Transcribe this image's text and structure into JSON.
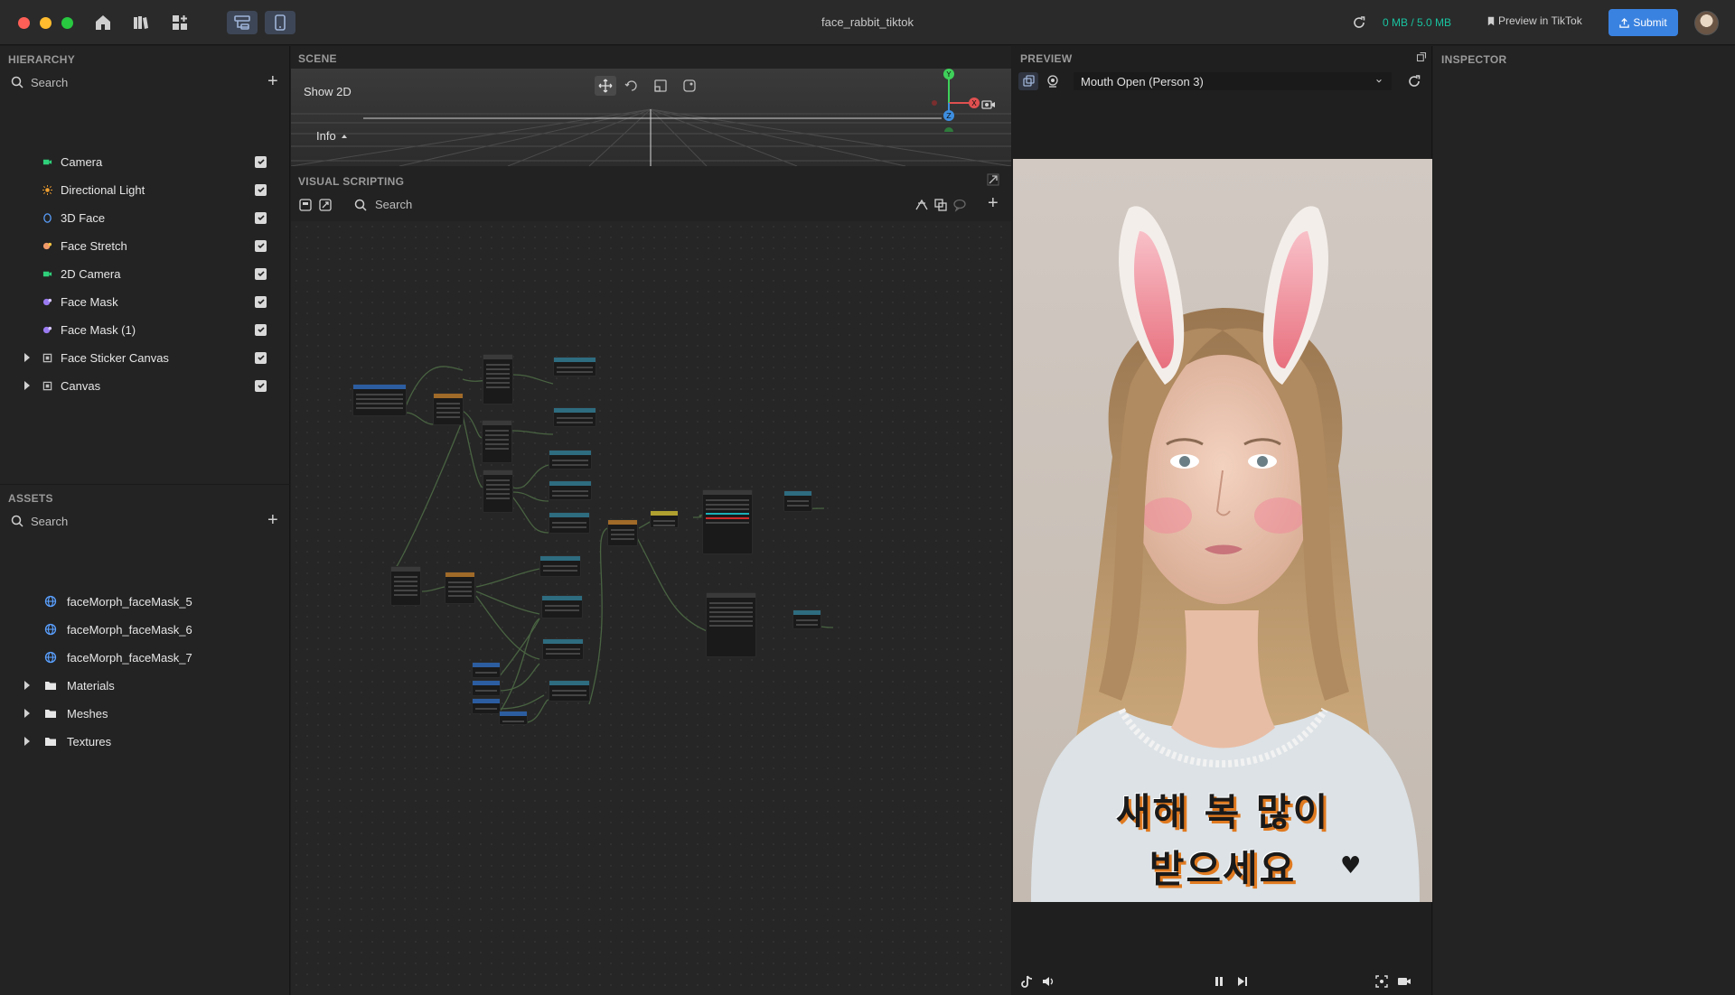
{
  "window": {
    "title": "face_rabbit_tiktok",
    "size_usage": "0 MB / 5.0 MB",
    "preview_in_tiktok_label": "Preview in TikTok",
    "submit_label": "Submit"
  },
  "hierarchy": {
    "title": "HIERARCHY",
    "search_placeholder": "Search",
    "items": [
      {
        "label": "Camera",
        "icon": "camera-icon",
        "color": "#2fd07a",
        "checked": true,
        "expandable": false
      },
      {
        "label": "Directional Light",
        "icon": "sun-icon",
        "color": "#f0a030",
        "checked": true,
        "expandable": false
      },
      {
        "label": "3D Face",
        "icon": "face-3d-icon",
        "color": "#5aa0ff",
        "checked": true,
        "expandable": false
      },
      {
        "label": "Face Stretch",
        "icon": "face-stretch-icon",
        "color": "#f09a6a",
        "checked": true,
        "expandable": false
      },
      {
        "label": "2D Camera",
        "icon": "camera-icon",
        "color": "#2fd07a",
        "checked": true,
        "expandable": false
      },
      {
        "label": "Face Mask",
        "icon": "face-mask-icon",
        "color": "#9a7af0",
        "checked": true,
        "expandable": false
      },
      {
        "label": "Face Mask (1)",
        "icon": "face-mask-icon",
        "color": "#9a7af0",
        "checked": true,
        "expandable": false
      },
      {
        "label": "Face Sticker Canvas",
        "icon": "canvas-icon",
        "color": "#bdbdbd",
        "checked": true,
        "expandable": true
      },
      {
        "label": "Canvas",
        "icon": "canvas-icon",
        "color": "#bdbdbd",
        "checked": true,
        "expandable": true
      }
    ]
  },
  "assets": {
    "title": "ASSETS",
    "search_placeholder": "Search",
    "items": [
      {
        "label": "faceMorph_faceMask_5",
        "icon": "globe-icon",
        "expandable": false
      },
      {
        "label": "faceMorph_faceMask_6",
        "icon": "globe-icon",
        "expandable": false
      },
      {
        "label": "faceMorph_faceMask_7",
        "icon": "globe-icon",
        "expandable": false
      },
      {
        "label": "Materials",
        "icon": "folder-icon",
        "expandable": true
      },
      {
        "label": "Meshes",
        "icon": "folder-icon",
        "expandable": true
      },
      {
        "label": "Textures",
        "icon": "folder-icon",
        "expandable": true
      }
    ]
  },
  "scene": {
    "title": "SCENE",
    "show_2d_label": "Show 2D",
    "info_label": "Info",
    "gizmo": {
      "y": "Y",
      "x": "X",
      "z": "Z"
    }
  },
  "visual_scripting": {
    "title": "VISUAL SCRIPTING",
    "search_placeholder": "Search"
  },
  "preview": {
    "title": "PREVIEW",
    "selected_trigger": "Mouth Open (Person 3)",
    "overlay_line1": "새해 복 많이",
    "overlay_line2": "받으세요"
  },
  "inspector": {
    "title": "INSPECTOR"
  },
  "colors": {
    "accent": "#3a82e0",
    "size_ok": "#19c3a0"
  }
}
